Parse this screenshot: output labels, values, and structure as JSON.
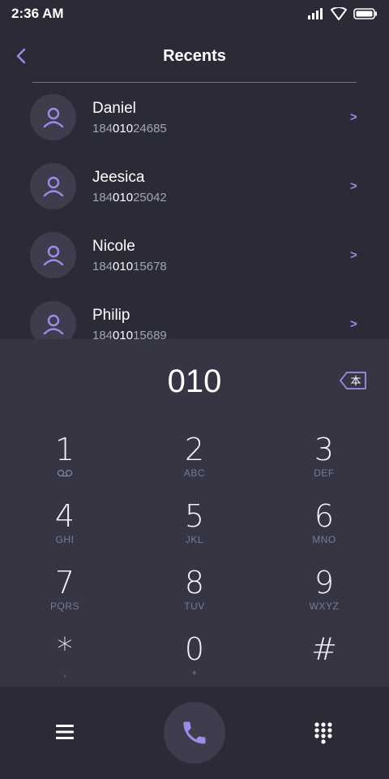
{
  "status_bar": {
    "time": "2:36 AM"
  },
  "header": {
    "title": "Recents"
  },
  "contacts": [
    {
      "name": "Daniel",
      "number_prefix": "184",
      "number_match": "010",
      "number_suffix": "24685"
    },
    {
      "name": "Jeesica",
      "number_prefix": "184",
      "number_match": "010",
      "number_suffix": "25042"
    },
    {
      "name": "Nicole",
      "number_prefix": "184",
      "number_match": "010",
      "number_suffix": "15678"
    },
    {
      "name": "Philip",
      "number_prefix": "184",
      "number_match": "010",
      "number_suffix": "15689"
    }
  ],
  "contact_chevron": ">",
  "dialer": {
    "input": "010",
    "backspace_glyph": "本"
  },
  "keys": [
    {
      "digit": "1",
      "sub": ""
    },
    {
      "digit": "2",
      "sub": "ABC"
    },
    {
      "digit": "3",
      "sub": "DEF"
    },
    {
      "digit": "4",
      "sub": "GHI"
    },
    {
      "digit": "5",
      "sub": "JKL"
    },
    {
      "digit": "6",
      "sub": "MNO"
    },
    {
      "digit": "7",
      "sub": "PQRS"
    },
    {
      "digit": "8",
      "sub": "TUV"
    },
    {
      "digit": "9",
      "sub": "WXYZ"
    },
    {
      "digit": "*",
      "sub": ","
    },
    {
      "digit": "0",
      "sub": "+"
    },
    {
      "digit": "#",
      "sub": ""
    }
  ],
  "icons": {
    "back": "back-chevron-icon",
    "avatar": "person-icon",
    "voicemail": "voicemail-icon",
    "backspace": "backspace-icon",
    "menu": "menu-icon",
    "call": "phone-icon",
    "keypad": "keypad-icon",
    "signal": "signal-icon",
    "wifi": "wifi-icon",
    "battery": "battery-icon"
  },
  "colors": {
    "background": "#2b2b38",
    "dialpad": "#353544",
    "accent": "#9b8ee8",
    "secondary_text": "#a3a3b8"
  }
}
